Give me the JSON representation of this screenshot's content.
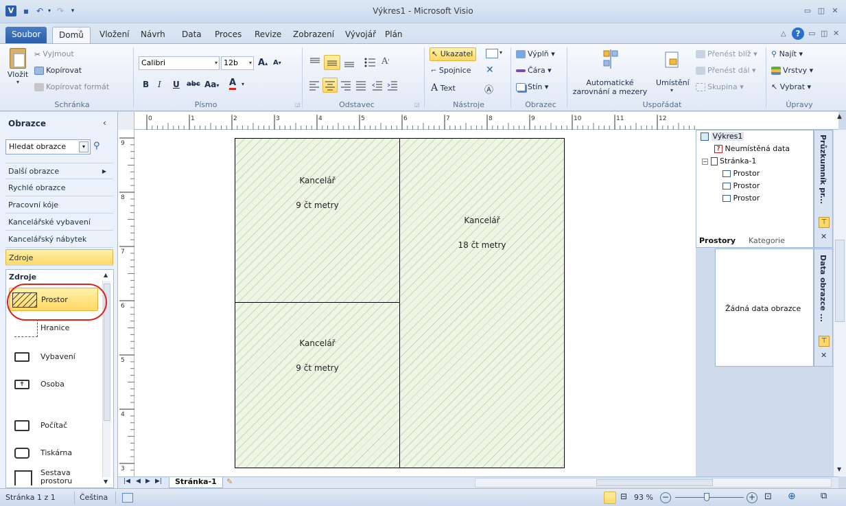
{
  "window": {
    "title": "Výkres1 - Microsoft Visio"
  },
  "tabs": [
    {
      "label": "Soubor"
    },
    {
      "label": "Domů"
    },
    {
      "label": "Vložení"
    },
    {
      "label": "Návrh"
    },
    {
      "label": "Data"
    },
    {
      "label": "Proces"
    },
    {
      "label": "Revize"
    },
    {
      "label": "Zobrazení"
    },
    {
      "label": "Vývojář"
    },
    {
      "label": "Plán"
    }
  ],
  "ribbon": {
    "clipboard": {
      "label": "Schránka",
      "paste": "Vložit",
      "cut": "Vyjmout",
      "copy": "Kopírovat",
      "format_painter": "Kopírovat formát"
    },
    "font": {
      "label": "Písmo",
      "family": "Calibri",
      "size": "12b"
    },
    "paragraph": {
      "label": "Odstavec"
    },
    "tools": {
      "label": "Nástroje",
      "pointer": "Ukazatel",
      "connector": "Spojnice",
      "text": "Text"
    },
    "shape": {
      "label": "Obrazec",
      "fill": "Výplň",
      "line": "Čára",
      "shadow": "Stín"
    },
    "arrange": {
      "label": "Uspořádat",
      "auto_align_1": "Automatické",
      "auto_align_2": "zarovnání a mezery",
      "position": "Umístění",
      "bring_forward": "Přenést blíž",
      "send_backward": "Přenést dál",
      "group": "Skupina"
    },
    "editing": {
      "label": "Úpravy",
      "find": "Najít",
      "layers": "Vrstvy",
      "select": "Vybrat"
    }
  },
  "shapes_pane": {
    "title": "Obrazce",
    "search_placeholder": "Hledat obrazce",
    "more_shapes": "Další obrazce",
    "items": [
      {
        "label": "Rychlé obrazce"
      },
      {
        "label": "Pracovní kóje"
      },
      {
        "label": "Kancelářské vybavení"
      },
      {
        "label": "Kancelářský nábytek"
      },
      {
        "label": "Zdroje"
      }
    ],
    "stencil_title": "Zdroje",
    "stencil_shapes": [
      {
        "label": "Prostor"
      },
      {
        "label": "Hranice"
      },
      {
        "label": "Vybavení"
      },
      {
        "label": "Osoba"
      },
      {
        "label": "Počítač"
      },
      {
        "label": "Tiskárna"
      },
      {
        "label": "Sestava prostoru"
      }
    ]
  },
  "ruler": {
    "h_ticks": [
      "0",
      "1",
      "2",
      "3",
      "4",
      "5",
      "6",
      "7",
      "8",
      "9",
      "10",
      "11",
      "12"
    ],
    "v_ticks": [
      "9",
      "8",
      "7",
      "6",
      "5",
      "4",
      "3"
    ]
  },
  "drawing": {
    "rooms": [
      {
        "name": "Kancelář",
        "area": "9 čt metry"
      },
      {
        "name": "Kancelář",
        "area": "18 čt metry"
      },
      {
        "name": "Kancelář",
        "area": "9 čt metry"
      }
    ]
  },
  "explorer": {
    "title": "Průzkumník pr...",
    "root": "Výkres1",
    "unplaced": "Neumístěná data",
    "page": "Stránka-1",
    "spaces": [
      "Prostor",
      "Prostor",
      "Prostor"
    ],
    "tab_spaces": "Prostory",
    "tab_categories": "Kategorie"
  },
  "shape_data": {
    "title": "Data obrazce ...",
    "empty": "Žádná data obrazce"
  },
  "page_tabs": {
    "current": "Stránka-1"
  },
  "status": {
    "page": "Stránka 1 z 1",
    "language": "Čeština",
    "zoom": "93 %"
  },
  "colors": {
    "accent": "#2a5ea8",
    "highlight": "#ffd867",
    "room_hatch": "#78a05a"
  }
}
